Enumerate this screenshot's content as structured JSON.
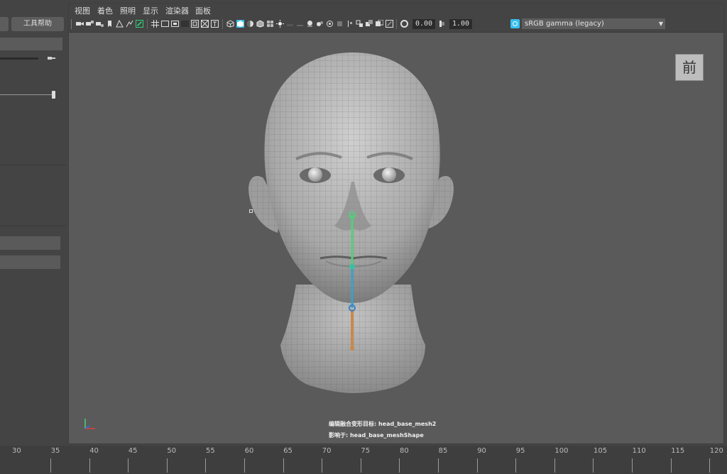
{
  "left_panel": {
    "tool_help_label": "工具帮助"
  },
  "menu": {
    "items": [
      "视图",
      "着色",
      "照明",
      "显示",
      "渲染器",
      "面板"
    ]
  },
  "toolbar": {
    "exposure_value": "0.00",
    "gamma_value": "1.00",
    "color_space": "sRGB gamma (legacy)"
  },
  "viewport": {
    "view_cube_label": "前",
    "info_line_1": "编辑融合变形目标: head_base_mesh2",
    "info_line_2": "影响于: head_base_meshShape",
    "accent_color": "#38c0f0"
  },
  "timeline": {
    "labels": [
      "30",
      "35",
      "40",
      "45",
      "50",
      "55",
      "60",
      "65",
      "70",
      "75",
      "80",
      "85",
      "90",
      "95",
      "100",
      "105",
      "110",
      "115",
      "120"
    ]
  }
}
